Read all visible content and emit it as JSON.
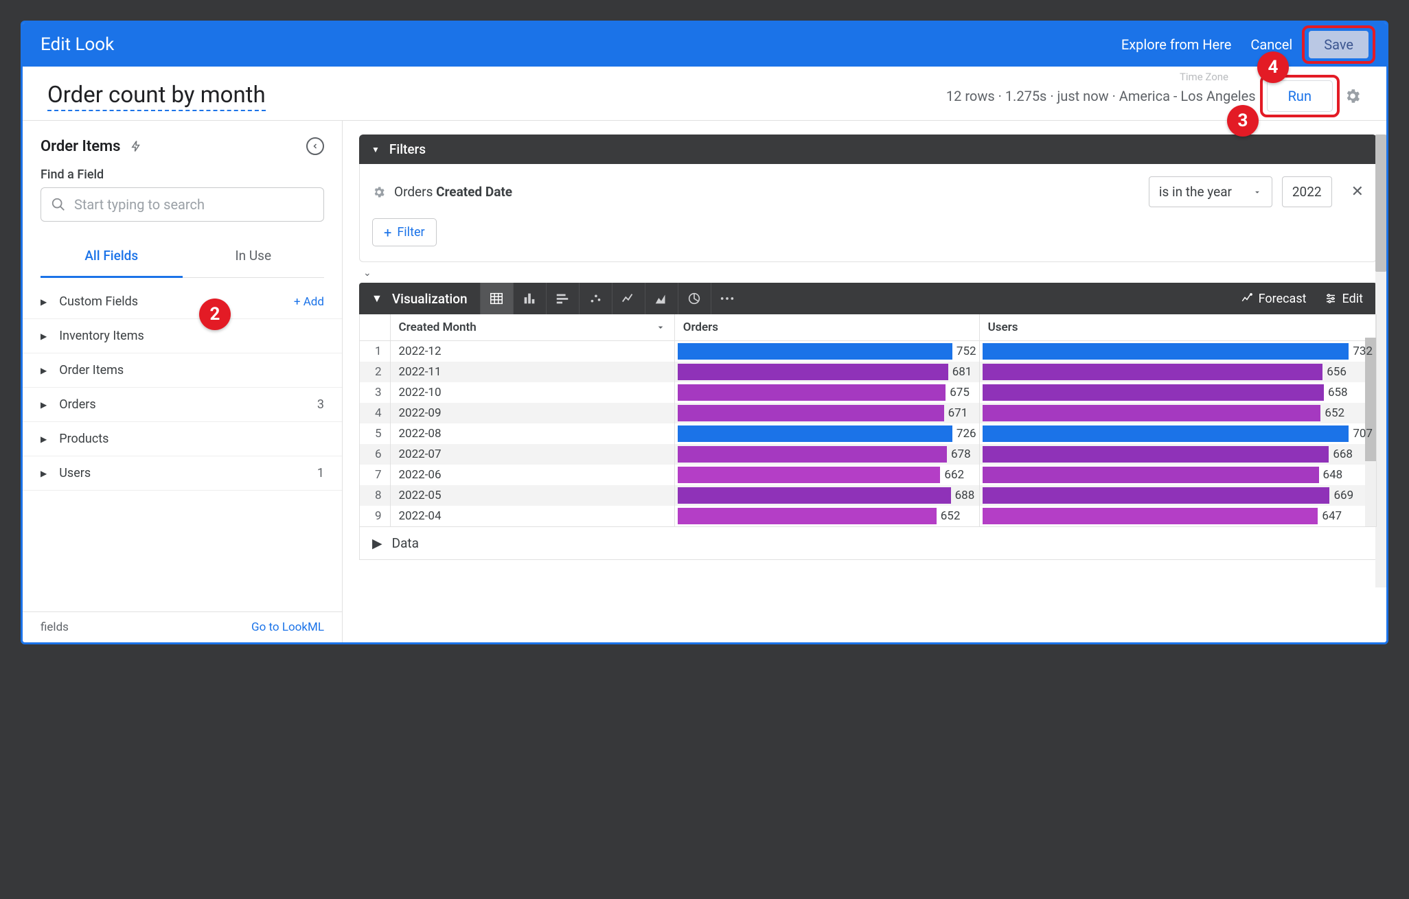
{
  "header": {
    "title": "Edit Look",
    "explore_link": "Explore from Here",
    "cancel_link": "Cancel",
    "save_label": "Save"
  },
  "subheader": {
    "look_title": "Order count by month",
    "timezone_hint": "Time Zone",
    "meta": "12 rows · 1.275s · just now · America - Los Angeles",
    "run_label": "Run"
  },
  "sidebar": {
    "explore_name": "Order Items",
    "find_label": "Find a Field",
    "search_placeholder": "Start typing to search",
    "tabs": {
      "all": "All Fields",
      "in_use": "In Use"
    },
    "add_label": "+  Add",
    "groups": [
      {
        "label": "Custom Fields",
        "add": true
      },
      {
        "label": "Inventory Items"
      },
      {
        "label": "Order Items"
      },
      {
        "label": "Orders",
        "count": 3
      },
      {
        "label": "Products"
      },
      {
        "label": "Users",
        "count": 1
      }
    ],
    "foot_left": "fields",
    "foot_right": "Go to LookML"
  },
  "filters": {
    "panel_label": "Filters",
    "items": [
      {
        "gear": true,
        "label_prefix": "Orders ",
        "label_bold": "Created Date",
        "op": "is in the year",
        "value": "2022"
      }
    ],
    "add_filter_label": "Filter"
  },
  "visualization": {
    "panel_label": "Visualization",
    "forecast_label": "Forecast",
    "edit_label": "Edit",
    "columns": [
      "Created Month",
      "Orders",
      "Users"
    ]
  },
  "data_panel_label": "Data",
  "annotations": {
    "b2": "2",
    "b3": "3",
    "b4": "4"
  },
  "chart_data": {
    "type": "table",
    "title": "Order count by month",
    "columns": [
      "Created Month",
      "Orders",
      "Users"
    ],
    "rows": [
      {
        "n": 1,
        "month": "2022-12",
        "orders": 752,
        "users": 732,
        "o_color": "#1b73e8",
        "u_color": "#1b73e8"
      },
      {
        "n": 2,
        "month": "2022-11",
        "orders": 681,
        "users": 656,
        "o_color": "#8f32b8",
        "u_color": "#8f32b8"
      },
      {
        "n": 3,
        "month": "2022-10",
        "orders": 675,
        "users": 658,
        "o_color": "#a539c0",
        "u_color": "#8f32b8"
      },
      {
        "n": 4,
        "month": "2022-09",
        "orders": 671,
        "users": 652,
        "o_color": "#a539c0",
        "u_color": "#a539c0"
      },
      {
        "n": 5,
        "month": "2022-08",
        "orders": 726,
        "users": 707,
        "o_color": "#1b73e8",
        "u_color": "#1b73e8"
      },
      {
        "n": 6,
        "month": "2022-07",
        "orders": 678,
        "users": 668,
        "o_color": "#a539c0",
        "u_color": "#8f32b8"
      },
      {
        "n": 7,
        "month": "2022-06",
        "orders": 662,
        "users": 648,
        "o_color": "#b43ec6",
        "u_color": "#a539c0"
      },
      {
        "n": 8,
        "month": "2022-05",
        "orders": 688,
        "users": 669,
        "o_color": "#8f32b8",
        "u_color": "#8f32b8"
      },
      {
        "n": 9,
        "month": "2022-04",
        "orders": 652,
        "users": 647,
        "o_color": "#b43ec6",
        "u_color": "#b43ec6"
      }
    ],
    "bar_max": 752
  }
}
